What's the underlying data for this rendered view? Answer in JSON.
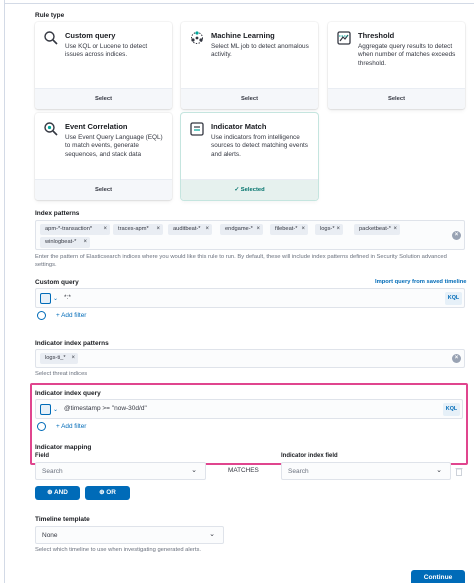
{
  "rule_type": {
    "label": "Rule type",
    "cards": [
      {
        "title": "Custom query",
        "desc": "Use KQL or Lucene to detect issues across indices.",
        "action": "Select",
        "icon": "search-icon",
        "selected": false
      },
      {
        "title": "Machine Learning",
        "desc": "Select ML job to detect anomalous activity.",
        "action": "Select",
        "icon": "ml-icon",
        "selected": false
      },
      {
        "title": "Threshold",
        "desc": "Aggregate query results to detect when number of matches exceeds threshold.",
        "action": "Select",
        "icon": "threshold-icon",
        "selected": false
      },
      {
        "title": "Event Correlation",
        "desc": "Use Event Query Language (EQL) to match events, generate sequences, and stack data",
        "action": "Select",
        "icon": "eql-icon",
        "selected": false
      },
      {
        "title": "Indicator Match",
        "desc": "Use indicators from intelligence sources to detect matching events and alerts.",
        "action": "✓ Selected",
        "icon": "indicator-icon",
        "selected": true
      }
    ]
  },
  "index_patterns": {
    "label": "Index patterns",
    "pills": [
      "apm-*-transaction*",
      "traces-apm*",
      "auditbeat-*",
      "endgame-*",
      "filebeat-*",
      "logs-*",
      "packetbeat-*",
      "winlogbeat-*"
    ],
    "help": "Enter the pattern of Elasticsearch indices where you would like this rule to run. By default, these will include index patterns defined in Security Solution advanced settings."
  },
  "custom_query": {
    "label": "Custom query",
    "import_link": "Import query from saved timeline",
    "value": "*:*",
    "kql": "KQL",
    "add_filter": "+ Add filter"
  },
  "indicator_index_patterns": {
    "label": "Indicator index patterns",
    "pills": [
      "logs-ti_*"
    ],
    "help": "Select threat indices"
  },
  "indicator_index_query": {
    "label": "Indicator index query",
    "value": "@timestamp >= \"now-30d/d\"",
    "kql": "KQL",
    "add_filter": "+ Add filter"
  },
  "indicator_mapping": {
    "label": "Indicator mapping",
    "field_label": "Field",
    "index_field_label": "Indicator index field",
    "field_placeholder": "Search",
    "index_field_placeholder": "Search",
    "matches": "MATCHES",
    "and_button": "AND",
    "or_button": "OR"
  },
  "timeline_template": {
    "label": "Timeline template",
    "value": "None",
    "help": "Select which timeline to use when investigating generated alerts."
  },
  "continue_button": "Continue",
  "colors": {
    "primary": "#006bb8",
    "success": "#00726b",
    "highlight": "#e0458e"
  }
}
